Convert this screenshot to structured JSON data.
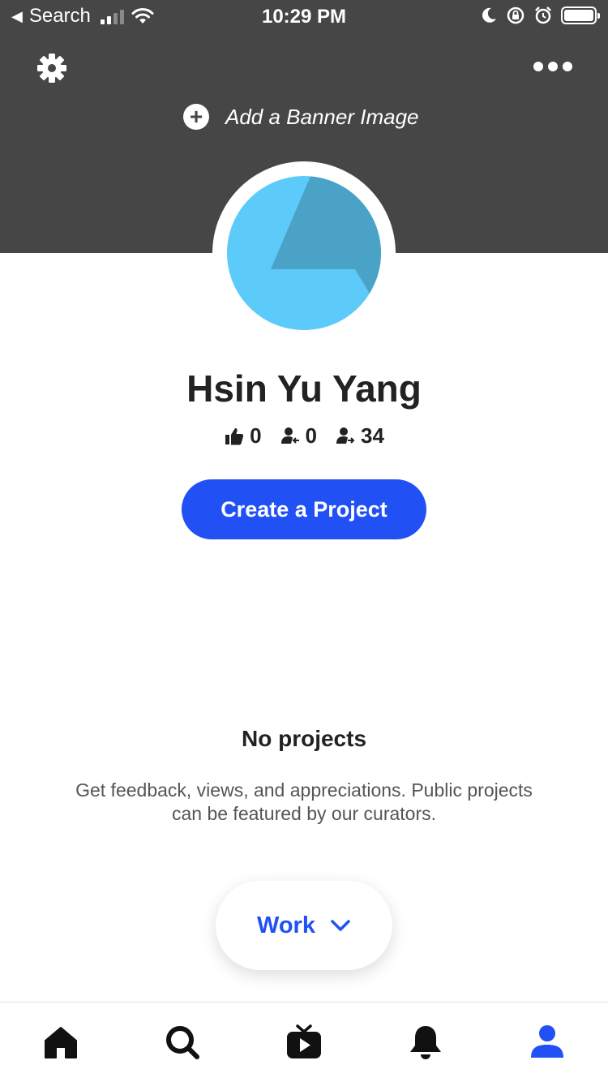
{
  "status_bar": {
    "back_label": "Search",
    "time": "10:29 PM"
  },
  "banner": {
    "add_banner_label": "Add a Banner Image"
  },
  "profile": {
    "name": "Hsin Yu Yang",
    "stats": {
      "appreciations": "0",
      "followers": "0",
      "following": "34"
    }
  },
  "actions": {
    "create_project_label": "Create a Project"
  },
  "empty_state": {
    "title": "No projects",
    "description": "Get feedback, views, and appreciations. Public projects can be featured by our curators."
  },
  "filter": {
    "selected": "Work"
  },
  "tab_bar": {
    "items": [
      {
        "icon": "home-icon"
      },
      {
        "icon": "search-icon"
      },
      {
        "icon": "live-tv-icon"
      },
      {
        "icon": "bell-icon"
      },
      {
        "icon": "profile-icon",
        "active": true
      }
    ]
  },
  "colors": {
    "accent": "#2151f5",
    "banner": "#464646",
    "avatar_light": "#5ccbf9",
    "avatar_dark": "#4aa2c6"
  }
}
